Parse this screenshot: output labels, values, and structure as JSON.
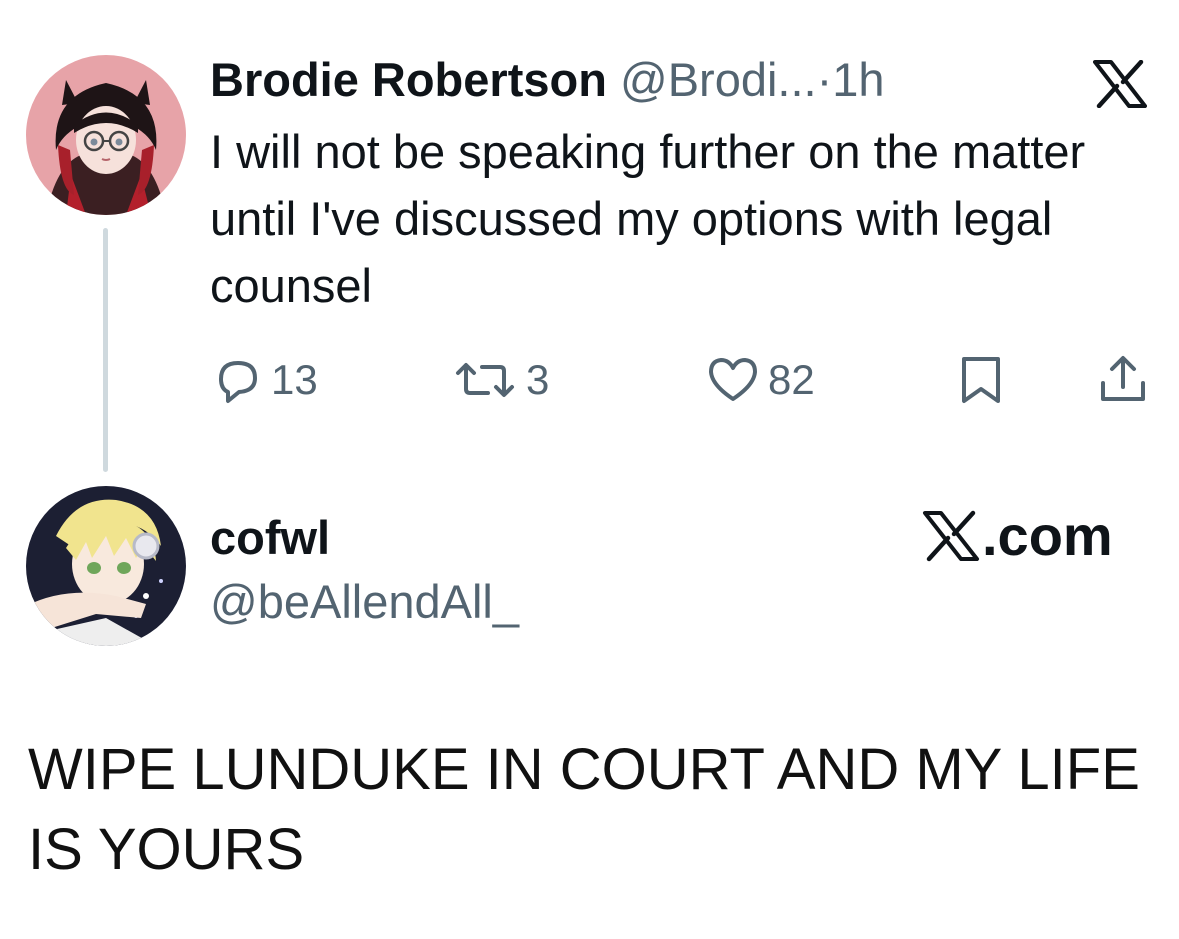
{
  "tweet": {
    "author_name": "Brodie Robertson",
    "author_handle": "@Brodi...",
    "separator": "·",
    "time": "1h",
    "text": "I will not be speaking further on the matter until I've discussed my options with legal counsel",
    "avatar_icon": "anime-girl-avatar",
    "platform_icon": "x-logo-icon",
    "actions": {
      "reply": {
        "icon": "reply-icon",
        "count": "13"
      },
      "retweet": {
        "icon": "retweet-icon",
        "count": "3"
      },
      "like": {
        "icon": "heart-icon",
        "count": "82"
      },
      "bookmark": {
        "icon": "bookmark-icon"
      },
      "share": {
        "icon": "share-icon"
      }
    }
  },
  "reply": {
    "author_name": "cofwl",
    "author_handle": "@beAllendAll_",
    "avatar_icon": "anime-boy-avatar",
    "source": ".com",
    "source_icon": "x-logo-icon"
  },
  "caption": "WIPE LUNDUKE IN COURT AND MY LIFE IS YOURS",
  "colors": {
    "text": "#0f1419",
    "muted": "#536471",
    "thread_line": "#cfd9de",
    "background": "#ffffff"
  }
}
